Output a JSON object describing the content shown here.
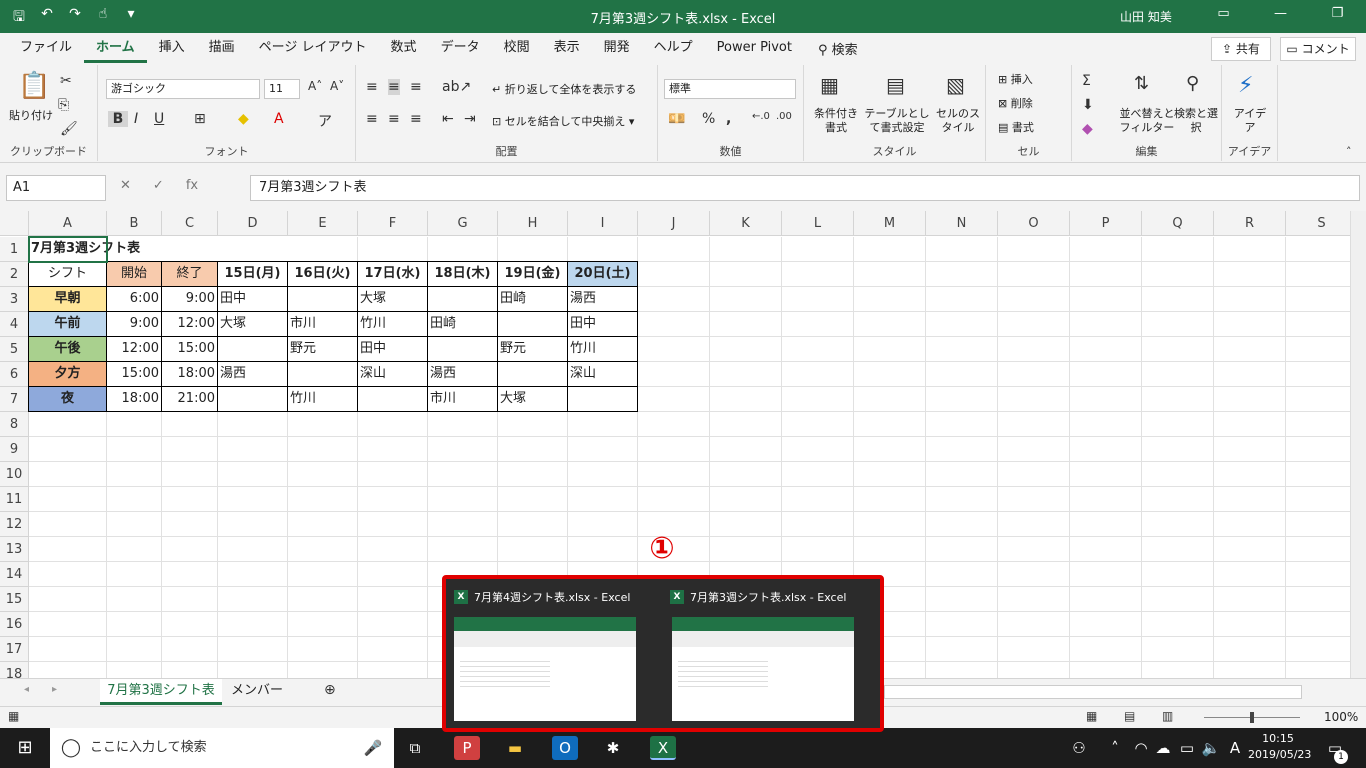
{
  "window": {
    "title": "7月第3週シフト表.xlsx  -  Excel",
    "user": "山田 知美"
  },
  "tabs": [
    "ファイル",
    "ホーム",
    "挿入",
    "描画",
    "ページ レイアウト",
    "数式",
    "データ",
    "校閲",
    "表示",
    "開発",
    "ヘルプ",
    "Power Pivot"
  ],
  "search_tab": "検索",
  "share_label": "共有",
  "comment_label": "コメント",
  "ribbon": {
    "clipboard": {
      "label": "クリップボード",
      "paste": "貼り付け"
    },
    "font": {
      "label": "フォント",
      "name": "游ゴシック",
      "size": "11"
    },
    "align": {
      "label": "配置",
      "wrap": "折り返して全体を表示する",
      "merge": "セルを結合して中央揃え"
    },
    "number": {
      "label": "数値",
      "format": "標準"
    },
    "style": {
      "label": "スタイル",
      "cond": "条件付き書式",
      "table": "テーブルとして書式設定",
      "cell": "セルのスタイル"
    },
    "cells": {
      "label": "セル",
      "insert": "挿入",
      "delete": "削除",
      "format": "書式"
    },
    "edit": {
      "label": "編集",
      "sort": "並べ替えとフィルター",
      "find": "検索と選択"
    },
    "idea": {
      "label": "アイデア",
      "btn": "アイデア"
    }
  },
  "formula": {
    "namebox": "A1",
    "content": "7月第3週シフト表"
  },
  "columns": [
    "A",
    "B",
    "C",
    "D",
    "E",
    "F",
    "G",
    "H",
    "I",
    "J",
    "K",
    "L",
    "M",
    "N",
    "O",
    "P",
    "Q",
    "R",
    "S"
  ],
  "rows": [
    "1",
    "2",
    "3",
    "4",
    "5",
    "6",
    "7",
    "8",
    "9",
    "10",
    "11",
    "12",
    "13",
    "14",
    "15",
    "16",
    "17",
    "18"
  ],
  "sheet": {
    "title": "7月第3週シフト表",
    "header": [
      "シフト",
      "開始",
      "終了",
      "15日(月)",
      "16日(火)",
      "17日(水)",
      "18日(木)",
      "19日(金)",
      "20日(土)"
    ],
    "data": [
      [
        "早朝",
        "6:00",
        "9:00",
        "田中",
        "",
        "大塚",
        "",
        "田崎",
        "湯西"
      ],
      [
        "午前",
        "9:00",
        "12:00",
        "大塚",
        "市川",
        "竹川",
        "田崎",
        "",
        "田中"
      ],
      [
        "午後",
        "12:00",
        "15:00",
        "",
        "野元",
        "田中",
        "",
        "野元",
        "竹川"
      ],
      [
        "夕方",
        "15:00",
        "18:00",
        "湯西",
        "",
        "深山",
        "湯西",
        "",
        "深山"
      ],
      [
        "夜",
        "18:00",
        "21:00",
        "",
        "竹川",
        "",
        "市川",
        "大塚",
        ""
      ]
    ],
    "shift_colors": [
      "#ffe699",
      "#bdd7ee",
      "#a9d08e",
      "#f4b183",
      "#8ea9db"
    ]
  },
  "sheet_tabs": [
    "7月第3週シフト表",
    "メンバー"
  ],
  "zoom": "100%",
  "taskbar": {
    "search": "ここに入力して検索",
    "time": "10:15",
    "date": "2019/05/23",
    "ime": "A",
    "notif": "1"
  },
  "preview": {
    "items": [
      "7月第4週シフト表.xlsx - Excel",
      "7月第3週シフト表.xlsx - Excel"
    ],
    "callout": "①"
  }
}
